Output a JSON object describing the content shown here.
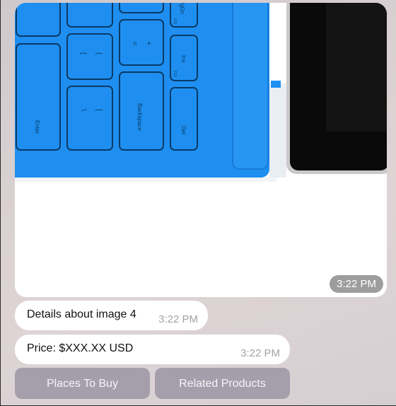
{
  "image_message": {
    "time": "3:22 PM",
    "keys": {
      "pgdn": "PgDn",
      "f11": "F11",
      "ins": "Ins",
      "f12": "F12",
      "enter": "Enter",
      "backspace": "Backspace",
      "del": "Del",
      "bracket_open": "[",
      "brace_open": "{",
      "bracket_close": "]",
      "brace_close": "}",
      "equals": "=",
      "plus": "+",
      "backslash": "\\",
      "pipe": "|"
    }
  },
  "messages": [
    {
      "text": "Details about image 4",
      "time": "3:22 PM"
    },
    {
      "text": "Price: $XXX.XX USD",
      "time": "3:22 PM"
    }
  ],
  "buttons": {
    "places_to_buy": "Places To Buy",
    "related_products": "Related Products"
  },
  "colors": {
    "keyboard_blue": "#1e8ff0",
    "key_outline": "#0b3a66",
    "tablet": "#0a0a0a"
  }
}
